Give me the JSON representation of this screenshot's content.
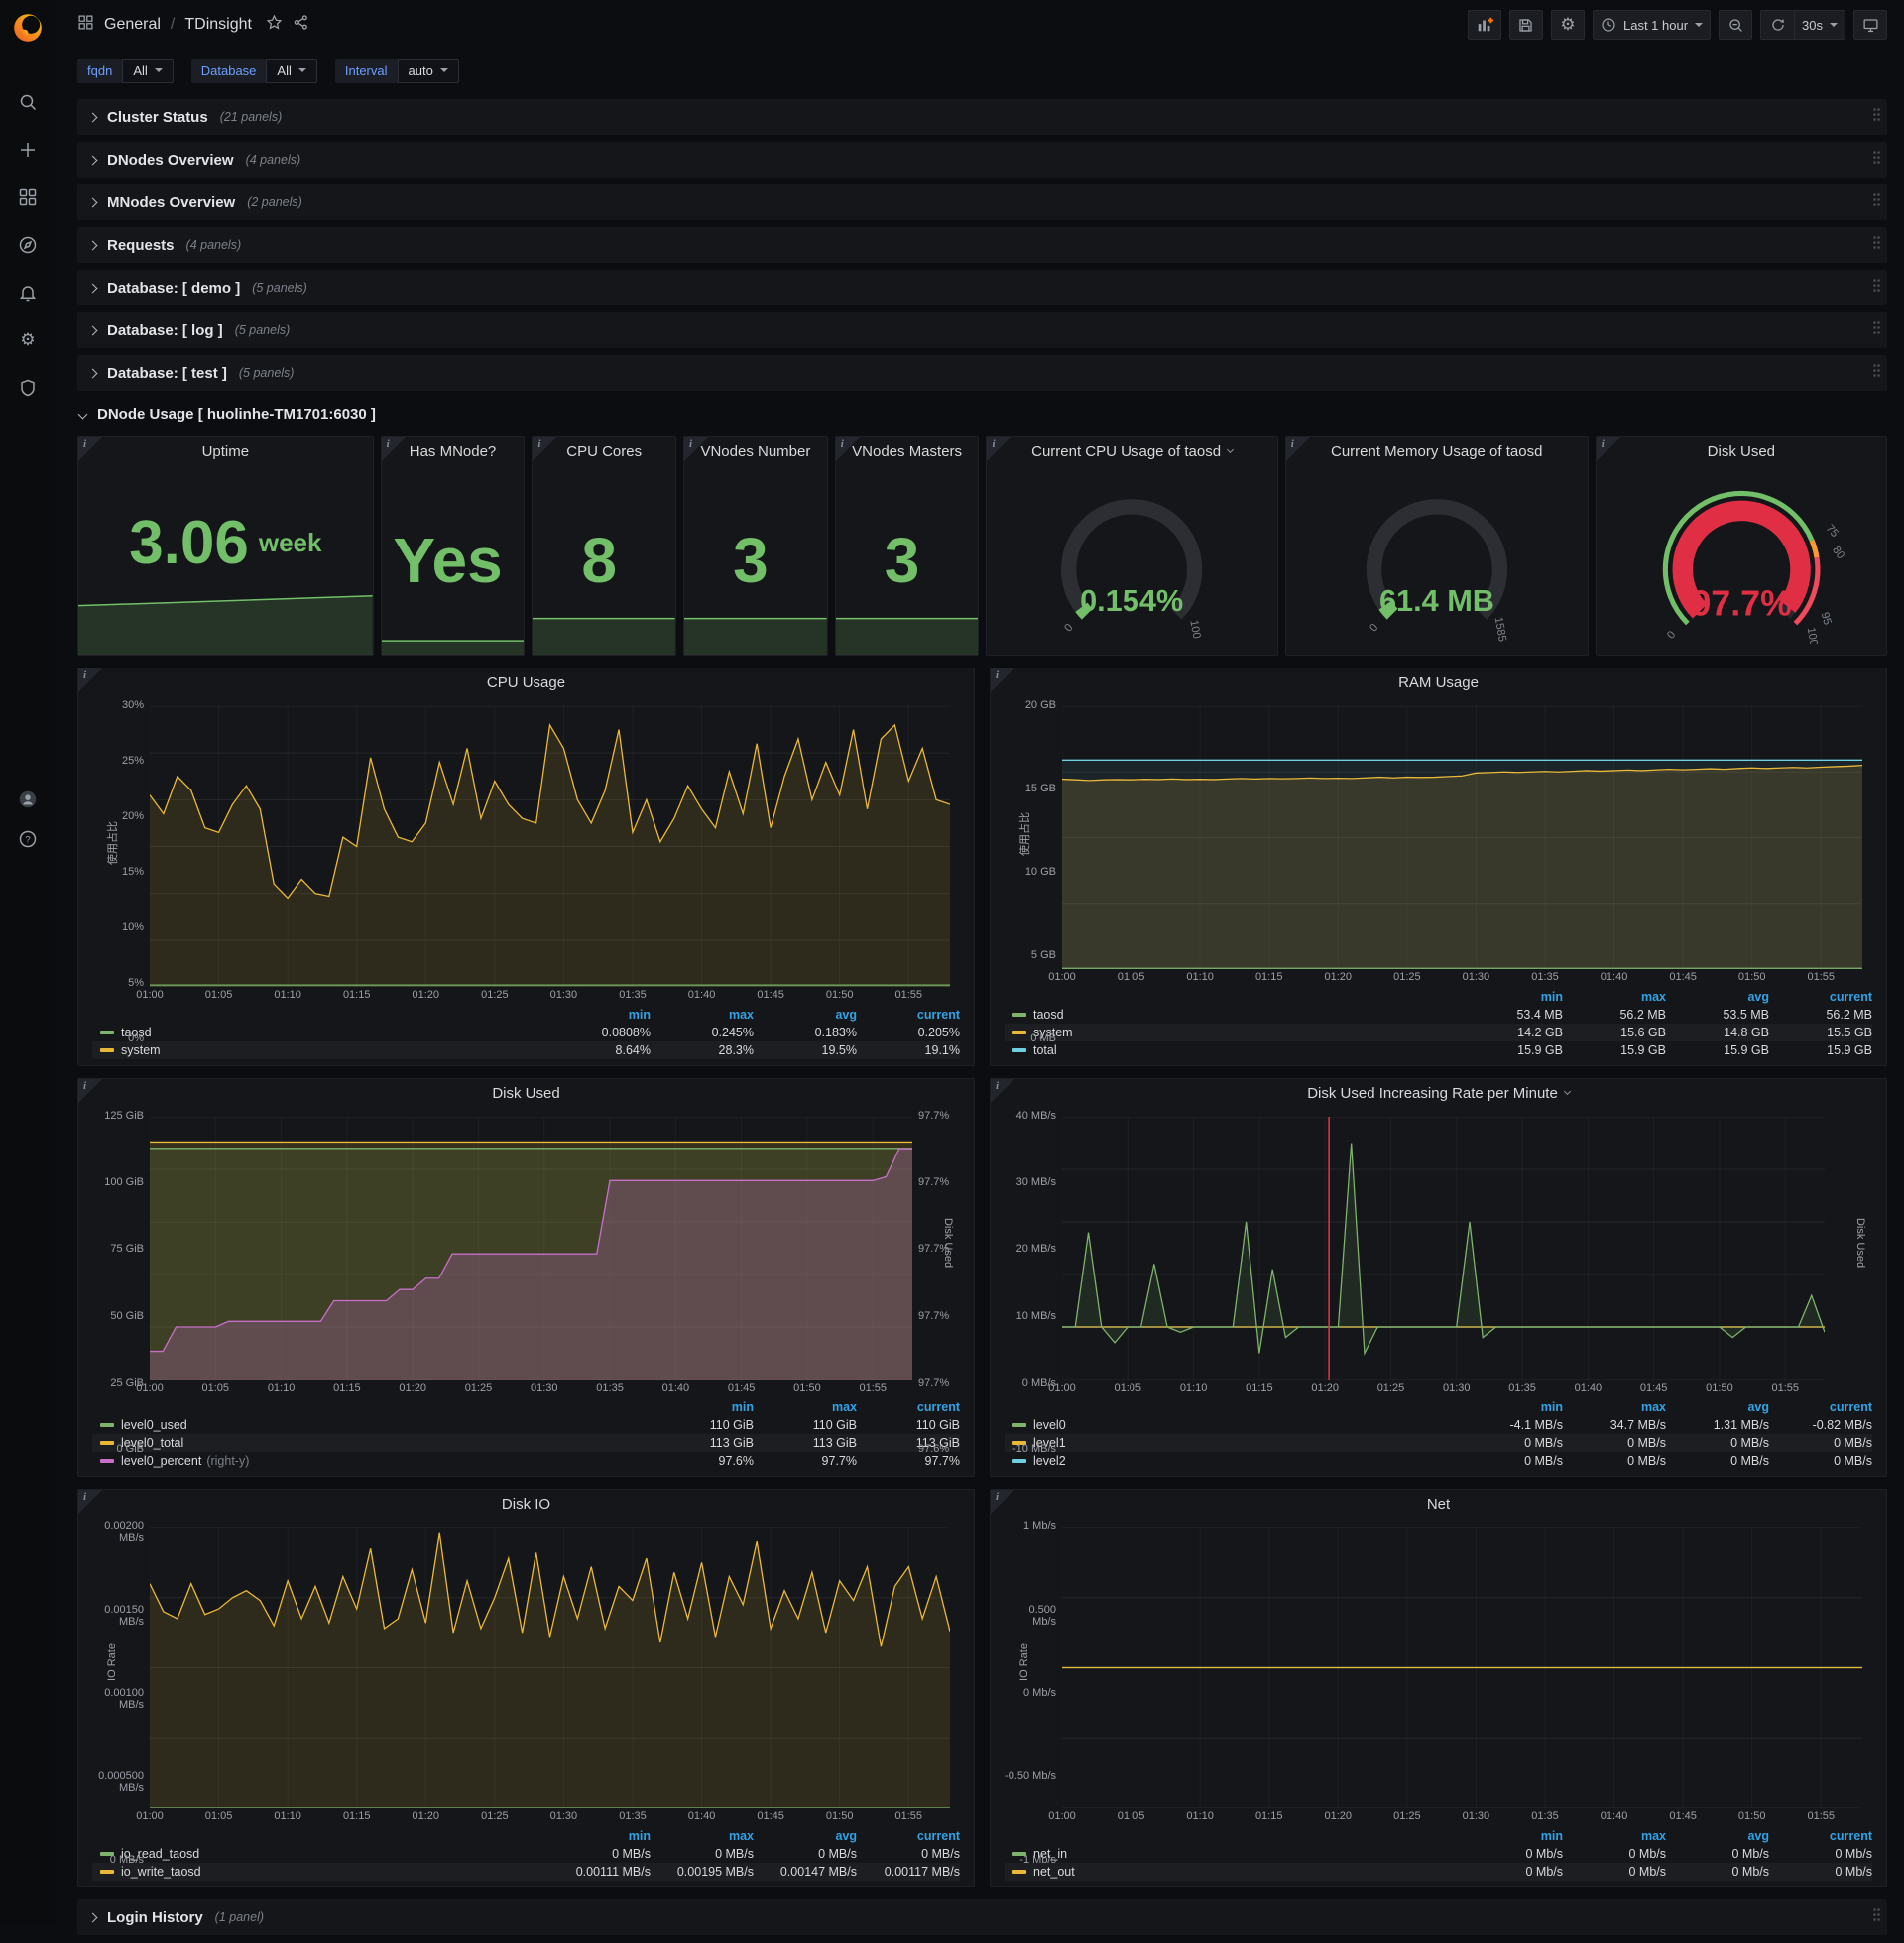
{
  "topnav": {
    "breadcrumb": {
      "section": "General",
      "separator": "/",
      "page": "TDinsight"
    },
    "time_range": "Last 1 hour",
    "refresh_interval": "30s"
  },
  "variables": [
    {
      "label": "fqdn",
      "value": "All"
    },
    {
      "label": "Database",
      "value": "All"
    },
    {
      "label": "Interval",
      "value": "auto"
    }
  ],
  "collapsed_rows_top": [
    {
      "title": "Cluster Status",
      "count": "(21 panels)"
    },
    {
      "title": "DNodes Overview",
      "count": "(4 panels)"
    },
    {
      "title": "MNodes Overview",
      "count": "(2 panels)"
    },
    {
      "title": "Requests",
      "count": "(4 panels)"
    },
    {
      "title": "Database: [ demo ]",
      "count": "(5 panels)"
    },
    {
      "title": "Database: [ log ]",
      "count": "(5 panels)"
    },
    {
      "title": "Database: [ test ]",
      "count": "(5 panels)"
    }
  ],
  "expanded_row": {
    "title": "DNode Usage [ huolinhe-TM1701:6030 ]"
  },
  "collapsed_rows_bottom": [
    {
      "title": "Login History",
      "count": "(1 panel)"
    }
  ],
  "stats": [
    {
      "title": "Uptime",
      "value": "3.06",
      "suffix": "week",
      "spark": "big"
    },
    {
      "title": "Has MNode?",
      "value": "Yes",
      "spark": "line"
    },
    {
      "title": "CPU Cores",
      "value": "8",
      "spark": "area"
    },
    {
      "title": "VNodes Number",
      "value": "3",
      "spark": "area"
    },
    {
      "title": "VNodes Masters",
      "value": "3",
      "spark": "area"
    }
  ],
  "gauges": [
    {
      "title": "Current CPU Usage of taosd",
      "menu": true,
      "value": "0.154%",
      "pct": 0.00154,
      "style": "simple",
      "color": "#73BF69",
      "labels": [
        [
          "0",
          0
        ],
        [
          "100",
          1
        ]
      ]
    },
    {
      "title": "Current Memory Usage of taosd",
      "menu": false,
      "value": "61.4 MB",
      "pct": 0.0387,
      "style": "simple",
      "color": "#73BF69",
      "labels": [
        [
          "0",
          0
        ],
        [
          "1585",
          1
        ]
      ]
    },
    {
      "title": "Disk Used",
      "menu": false,
      "value": "97.7%",
      "pct": 0.977,
      "style": "threshold",
      "color": "#E02F44",
      "labels": [
        [
          "0",
          0
        ],
        [
          "75",
          0.75
        ],
        [
          "80",
          0.8
        ],
        [
          "95",
          0.95
        ],
        [
          "100",
          1
        ]
      ],
      "thresholds": [
        {
          "to": 0.75,
          "color": "#73BF69"
        },
        {
          "to": 0.8,
          "color": "#FF9830"
        },
        {
          "to": 1,
          "color": "#F2495C"
        }
      ]
    }
  ],
  "chart_data": [
    {
      "type": "area",
      "title": "CPU Usage",
      "ylabel": "使用占比",
      "ylim": [
        0,
        30
      ],
      "yticks": [
        {
          "v": 0,
          "label": "0%"
        },
        {
          "v": 5,
          "label": "5%"
        },
        {
          "v": 10,
          "label": "10%"
        },
        {
          "v": 15,
          "label": "15%"
        },
        {
          "v": 20,
          "label": "20%"
        },
        {
          "v": 25,
          "label": "25%"
        },
        {
          "v": 30,
          "label": "30%"
        }
      ],
      "xticks": [
        "01:00",
        "01:05",
        "01:10",
        "01:15",
        "01:20",
        "01:25",
        "01:30",
        "01:35",
        "01:40",
        "01:45",
        "01:50",
        "01:55"
      ],
      "series": [
        {
          "name": "system",
          "color": "#EAB839",
          "fill": 0.13,
          "values": [
            20.5,
            18.5,
            22.5,
            21,
            17,
            16.5,
            19.5,
            21.5,
            19,
            11,
            9.5,
            11.5,
            10,
            9.7,
            16,
            15,
            24.5,
            19,
            16,
            15.5,
            17.5,
            24,
            19.5,
            25.5,
            18,
            22,
            19.5,
            18,
            17.5,
            28,
            25.5,
            20,
            17.5,
            21,
            27.5,
            16.5,
            20,
            15.5,
            18,
            21.5,
            19,
            17,
            23,
            18.5,
            26,
            17,
            22.5,
            26.5,
            20,
            24,
            20.5,
            27.5,
            19,
            26.5,
            28,
            22,
            25.5,
            20,
            19.5
          ]
        },
        {
          "name": "taosd",
          "color": "#7EB26D",
          "fill": 0.1,
          "flat": 0.2
        }
      ],
      "legend": {
        "columns": [
          "min",
          "max",
          "avg",
          "current"
        ],
        "rows": [
          {
            "name": "taosd",
            "color": "#7EB26D",
            "values": [
              "0.0808%",
              "0.245%",
              "0.183%",
              "0.205%"
            ]
          },
          {
            "name": "system",
            "color": "#EAB839",
            "values": [
              "8.64%",
              "28.3%",
              "19.5%",
              "19.1%"
            ]
          }
        ]
      }
    },
    {
      "type": "area",
      "title": "RAM Usage",
      "ylabel": "使用占比",
      "ylim": [
        0,
        20
      ],
      "yticks": [
        {
          "v": 0,
          "label": "0 MB"
        },
        {
          "v": 5,
          "label": "5 GB"
        },
        {
          "v": 10,
          "label": "10 GB"
        },
        {
          "v": 15,
          "label": "15 GB"
        },
        {
          "v": 20,
          "label": "20 GB"
        }
      ],
      "xticks": [
        "01:00",
        "01:05",
        "01:10",
        "01:15",
        "01:20",
        "01:25",
        "01:30",
        "01:35",
        "01:40",
        "01:45",
        "01:50",
        "01:55"
      ],
      "series": [
        {
          "name": "total",
          "color": "#6ED0E0",
          "fill": 0.08,
          "flat": 15.9
        },
        {
          "name": "system",
          "color": "#EAB839",
          "fill": 0.14,
          "values": [
            14.45,
            14.4,
            14.35,
            14.4,
            14.42,
            14.4,
            14.44,
            14.42,
            14.46,
            14.42,
            14.44,
            14.42,
            14.46,
            14.5,
            14.46,
            14.5,
            14.48,
            14.5,
            14.54,
            14.5,
            14.52,
            14.5,
            14.55,
            14.6,
            14.55,
            14.6,
            14.58,
            14.6,
            14.65,
            14.7,
            14.92,
            14.95,
            15.0,
            14.96,
            15.0,
            15.04,
            15.0,
            15.05,
            15.1,
            15.06,
            15.1,
            15.14,
            15.1,
            15.15,
            15.2,
            15.16,
            15.2,
            15.24,
            15.2,
            15.26,
            15.3,
            15.26,
            15.3,
            15.34,
            15.3,
            15.36,
            15.4,
            15.44,
            15.5
          ]
        },
        {
          "name": "taosd",
          "color": "#7EB26D",
          "fill": 0.1,
          "flat": 0.055
        }
      ],
      "legend": {
        "columns": [
          "min",
          "max",
          "avg",
          "current"
        ],
        "rows": [
          {
            "name": "taosd",
            "color": "#7EB26D",
            "values": [
              "53.4 MB",
              "56.2 MB",
              "53.5 MB",
              "56.2 MB"
            ]
          },
          {
            "name": "system",
            "color": "#EAB839",
            "values": [
              "14.2 GB",
              "15.6 GB",
              "14.8 GB",
              "15.5 GB"
            ]
          },
          {
            "name": "total",
            "color": "#6ED0E0",
            "values": [
              "15.9 GB",
              "15.9 GB",
              "15.9 GB",
              "15.9 GB"
            ]
          }
        ]
      }
    },
    {
      "type": "area",
      "title": "Disk Used",
      "ylabel": "",
      "ylim": [
        0,
        125
      ],
      "ylim_right": [
        97.58,
        97.72
      ],
      "right_label": "Disk Used",
      "right_tick_labels": [
        "97.6%",
        "97.7%",
        "97.7%",
        "97.7%",
        "97.7%",
        "97.7%"
      ],
      "yticks": [
        {
          "v": 0,
          "label": "0 GiB"
        },
        {
          "v": 25,
          "label": "25 GiB"
        },
        {
          "v": 50,
          "label": "50 GiB"
        },
        {
          "v": 75,
          "label": "75 GiB"
        },
        {
          "v": 100,
          "label": "100 GiB"
        },
        {
          "v": 125,
          "label": "125 GiB"
        }
      ],
      "xticks": [
        "01:00",
        "01:05",
        "01:10",
        "01:15",
        "01:20",
        "01:25",
        "01:30",
        "01:35",
        "01:40",
        "01:45",
        "01:50",
        "01:55"
      ],
      "series": [
        {
          "name": "level0_total",
          "color": "#EAB839",
          "fill": 0.16,
          "flat": 113
        },
        {
          "name": "level0_used",
          "color": "#7EB26D",
          "fill": 0.12,
          "flat": 110
        },
        {
          "name": "level0_percent",
          "color": "#C86FC9",
          "fill": 0.25,
          "axis": "right",
          "values": [
            97.595,
            97.595,
            97.608,
            97.608,
            97.608,
            97.608,
            97.611,
            97.611,
            97.611,
            97.611,
            97.611,
            97.611,
            97.611,
            97.611,
            97.622,
            97.622,
            97.622,
            97.622,
            97.622,
            97.628,
            97.628,
            97.634,
            97.634,
            97.647,
            97.647,
            97.647,
            97.647,
            97.647,
            97.647,
            97.647,
            97.647,
            97.647,
            97.647,
            97.647,
            97.647,
            97.686,
            97.686,
            97.686,
            97.686,
            97.686,
            97.686,
            97.686,
            97.686,
            97.686,
            97.686,
            97.686,
            97.686,
            97.686,
            97.686,
            97.686,
            97.686,
            97.686,
            97.686,
            97.686,
            97.686,
            97.686,
            97.688,
            97.703,
            97.703
          ]
        }
      ],
      "legend": {
        "columns": [
          "min",
          "max",
          "current"
        ],
        "rows": [
          {
            "name": "level0_used",
            "color": "#7EB26D",
            "values": [
              "110 GiB",
              "110 GiB",
              "110 GiB"
            ]
          },
          {
            "name": "level0_total",
            "color": "#EAB839",
            "values": [
              "113 GiB",
              "113 GiB",
              "113 GiB"
            ]
          },
          {
            "name": "level0_percent",
            "note": "(right-y)",
            "color": "#C86FC9",
            "values": [
              "97.6%",
              "97.7%",
              "97.7%"
            ]
          }
        ]
      }
    },
    {
      "type": "line",
      "title": "Disk Used Increasing Rate per Minute",
      "menu": true,
      "ylabel": "",
      "ylim": [
        -10,
        40
      ],
      "right_label": "Disk Used",
      "yticks": [
        {
          "v": -10,
          "label": "-10 MB/s"
        },
        {
          "v": 0,
          "label": "0 MB/s"
        },
        {
          "v": 10,
          "label": "10 MB/s"
        },
        {
          "v": 20,
          "label": "20 MB/s"
        },
        {
          "v": 30,
          "label": "30 MB/s"
        },
        {
          "v": 40,
          "label": "40 MB/s"
        }
      ],
      "xticks": [
        "01:00",
        "01:05",
        "01:10",
        "01:15",
        "01:20",
        "01:25",
        "01:30",
        "01:35",
        "01:40",
        "01:45",
        "01:50",
        "01:55"
      ],
      "annotations": [
        {
          "x": 20.3,
          "color": "#E02F44"
        }
      ],
      "series": [
        {
          "name": "level2",
          "color": "#6ED0E0",
          "fill": 0,
          "flat": 0
        },
        {
          "name": "level1",
          "color": "#EAB839",
          "fill": 0,
          "flat": 0
        },
        {
          "name": "level0",
          "color": "#7EB26D",
          "fill": 0.12,
          "values": [
            0,
            0,
            18,
            0,
            -3,
            0,
            0,
            12,
            0,
            -1,
            0,
            0,
            0,
            0,
            20,
            -5,
            11,
            -2,
            0,
            0,
            0,
            0,
            35,
            -5,
            0,
            0,
            0,
            0,
            0,
            0,
            0,
            20,
            -2,
            0,
            0,
            0,
            0,
            0,
            0,
            0,
            0,
            0,
            0,
            0,
            0,
            0,
            0,
            0,
            0,
            0,
            0,
            -2,
            0,
            0,
            0,
            0,
            0,
            6,
            -1
          ]
        }
      ],
      "legend": {
        "columns": [
          "min",
          "max",
          "avg",
          "current"
        ],
        "rows": [
          {
            "name": "level0",
            "color": "#7EB26D",
            "values": [
              "-4.1 MB/s",
              "34.7 MB/s",
              "1.31 MB/s",
              "-0.82 MB/s"
            ]
          },
          {
            "name": "level1",
            "color": "#EAB839",
            "values": [
              "0 MB/s",
              "0 MB/s",
              "0 MB/s",
              "0 MB/s"
            ]
          },
          {
            "name": "level2",
            "color": "#6ED0E0",
            "values": [
              "0 MB/s",
              "0 MB/s",
              "0 MB/s",
              "0 MB/s"
            ]
          }
        ]
      }
    },
    {
      "type": "area",
      "title": "Disk IO",
      "ylabel": "IO Rate",
      "ylim": [
        0,
        0.002
      ],
      "yticks": [
        {
          "v": 0,
          "label": "0 MB/s"
        },
        {
          "v": 0.0005,
          "label": "0.000500 MB/s"
        },
        {
          "v": 0.001,
          "label": "0.00100 MB/s"
        },
        {
          "v": 0.0015,
          "label": "0.00150 MB/s"
        },
        {
          "v": 0.002,
          "label": "0.00200 MB/s"
        }
      ],
      "xticks": [
        "01:00",
        "01:05",
        "01:10",
        "01:15",
        "01:20",
        "01:25",
        "01:30",
        "01:35",
        "01:40",
        "01:45",
        "01:50",
        "01:55"
      ],
      "series": [
        {
          "name": "io_write_taosd",
          "color": "#EAB839",
          "fill": 0.13,
          "values": [
            0.0016,
            0.0014,
            0.00135,
            0.0016,
            0.00138,
            0.00142,
            0.0015,
            0.00155,
            0.00148,
            0.0013,
            0.00162,
            0.00135,
            0.00158,
            0.00132,
            0.00165,
            0.00142,
            0.00185,
            0.00128,
            0.00135,
            0.0017,
            0.00132,
            0.00196,
            0.00125,
            0.00162,
            0.00128,
            0.0015,
            0.00178,
            0.00125,
            0.00182,
            0.00122,
            0.00165,
            0.00135,
            0.00172,
            0.00128,
            0.00158,
            0.00148,
            0.00178,
            0.00118,
            0.00168,
            0.00135,
            0.00175,
            0.00122,
            0.00165,
            0.00145,
            0.0019,
            0.00128,
            0.00155,
            0.00135,
            0.00168,
            0.00125,
            0.00162,
            0.00148,
            0.00172,
            0.00115,
            0.00158,
            0.00172,
            0.00135,
            0.00165,
            0.00126
          ]
        },
        {
          "name": "io_read_taosd",
          "color": "#7EB26D",
          "fill": 0.08,
          "flat": 0
        }
      ],
      "legend": {
        "columns": [
          "min",
          "max",
          "avg",
          "current"
        ],
        "rows": [
          {
            "name": "io_read_taosd",
            "color": "#7EB26D",
            "values": [
              "0 MB/s",
              "0 MB/s",
              "0 MB/s",
              "0 MB/s"
            ]
          },
          {
            "name": "io_write_taosd",
            "color": "#EAB839",
            "values": [
              "0.00111 MB/s",
              "0.00195 MB/s",
              "0.00147 MB/s",
              "0.00117 MB/s"
            ]
          }
        ]
      }
    },
    {
      "type": "line",
      "title": "Net",
      "ylabel": "IO Rate",
      "ylim": [
        -1,
        1
      ],
      "yticks": [
        {
          "v": -1,
          "label": "-1 Mb/s"
        },
        {
          "v": -0.5,
          "label": "-0.50 Mb/s"
        },
        {
          "v": 0,
          "label": "0 Mb/s"
        },
        {
          "v": 0.5,
          "label": "0.500 Mb/s"
        },
        {
          "v": 1,
          "label": "1 Mb/s"
        }
      ],
      "xticks": [
        "01:00",
        "01:05",
        "01:10",
        "01:15",
        "01:20",
        "01:25",
        "01:30",
        "01:35",
        "01:40",
        "01:45",
        "01:50",
        "01:55"
      ],
      "series": [
        {
          "name": "net_in",
          "color": "#7EB26D",
          "fill": 0,
          "flat": 0
        },
        {
          "name": "net_out",
          "color": "#EAB839",
          "fill": 0,
          "flat": 0
        }
      ],
      "legend": {
        "columns": [
          "min",
          "max",
          "avg",
          "current"
        ],
        "rows": [
          {
            "name": "net_in",
            "color": "#7EB26D",
            "values": [
              "0 Mb/s",
              "0 Mb/s",
              "0 Mb/s",
              "0 Mb/s"
            ]
          },
          {
            "name": "net_out",
            "color": "#EAB839",
            "values": [
              "0 Mb/s",
              "0 Mb/s",
              "0 Mb/s",
              "0 Mb/s"
            ]
          }
        ]
      }
    }
  ]
}
